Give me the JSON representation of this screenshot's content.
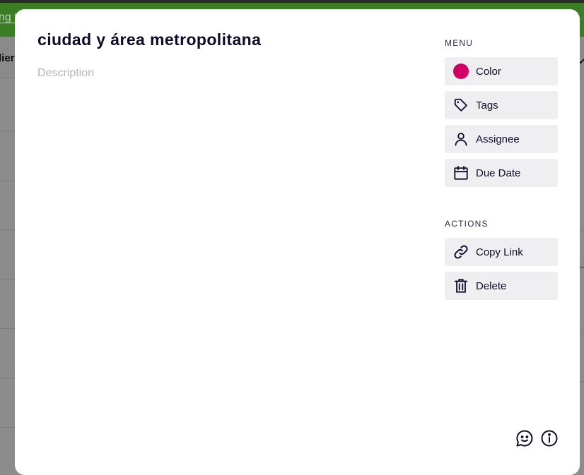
{
  "background": {
    "topbar_text": "ng t",
    "subbar_text": "lier"
  },
  "card": {
    "title": "ciudad y área metropolitana",
    "description_placeholder": "Description",
    "description_value": ""
  },
  "sidebar": {
    "menu_heading": "MENU",
    "menu_items": [
      {
        "label": "Color",
        "icon": "color-dot",
        "color": "#d10063"
      },
      {
        "label": "Tags",
        "icon": "tag-icon"
      },
      {
        "label": "Assignee",
        "icon": "user-icon"
      },
      {
        "label": "Due Date",
        "icon": "calendar-icon"
      }
    ],
    "actions_heading": "ACTIONS",
    "action_items": [
      {
        "label": "Copy Link",
        "icon": "link-icon"
      },
      {
        "label": "Delete",
        "icon": "trash-icon"
      }
    ]
  },
  "footer": {
    "icons": [
      "emoji-chat-icon",
      "info-icon"
    ]
  },
  "colors": {
    "modal_bg": "#ffffff",
    "button_bg": "#efeff2",
    "text": "#0d0d2b",
    "accent": "#d10063",
    "header_green": "#3a7d25"
  }
}
